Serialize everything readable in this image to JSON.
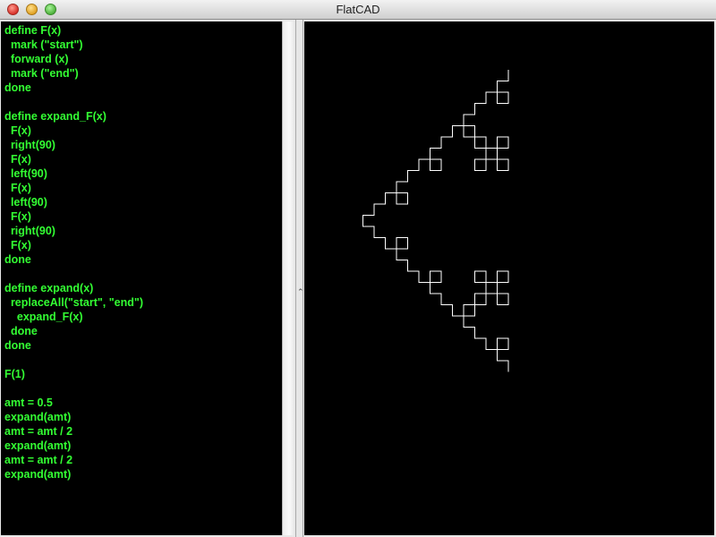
{
  "window": {
    "title": "FlatCAD"
  },
  "editor": {
    "lines": [
      "define F(x)",
      "  mark (\"start\")",
      "  forward (x)",
      "  mark (\"end\")",
      "done",
      "",
      "define expand_F(x)",
      "  F(x)",
      "  right(90)",
      "  F(x)",
      "  left(90)",
      "  F(x)",
      "  left(90)",
      "  F(x)",
      "  right(90)",
      "  F(x)",
      "done",
      "",
      "define expand(x)",
      "  replaceAll(\"start\", \"end\")",
      "    expand_F(x)",
      "  done",
      "done",
      "",
      "F(1)",
      "",
      "amt = 0.5",
      "expand(amt)",
      "amt = amt / 2",
      "expand(amt)",
      "amt = amt / 2",
      "expand(amt)"
    ]
  },
  "splitter": {
    "grip": "⌃"
  },
  "canvas": {
    "stroke": "#ffffff",
    "background": "#000000"
  },
  "colors": {
    "code": "#33ff33",
    "editor_bg": "#000000"
  }
}
